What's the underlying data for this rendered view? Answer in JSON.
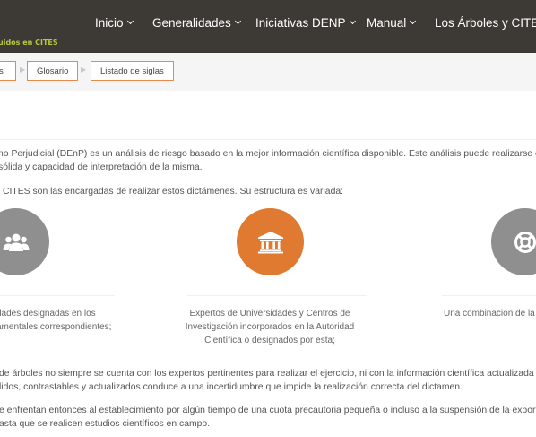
{
  "header": {
    "brand": "uidos en CITES",
    "nav": [
      {
        "label": "Inicio"
      },
      {
        "label": "Generalidades"
      },
      {
        "label": "Iniciativas DENP"
      },
      {
        "label": "Manual"
      },
      {
        "label": "Los Árboles y CITES"
      }
    ]
  },
  "breadcrumb": {
    "items": [
      {
        "label": "s"
      },
      {
        "label": "Glosario"
      },
      {
        "label": "Listado de siglas"
      }
    ]
  },
  "content": {
    "intro_line1": "no Perjudicial (DEnP) es un análisis de riesgo basado en la mejor información científica disponible. Este análisis puede realizarse en",
    "intro_line2": "sólida y capacidad de interpretación de la misma.",
    "structure_line": "CITES son las encargadas de realizar estos dictámenes. Su estructura es variada:",
    "columns": [
      {
        "icon": "group-icon",
        "lines": [
          "dades designadas en los",
          "amentales correspondientes;"
        ]
      },
      {
        "icon": "institution-icon",
        "lines": [
          "Expertos de Universidades y Centros de",
          "Investigación incorporados en la Autoridad",
          "Científica o designados por esta;"
        ]
      },
      {
        "icon": "lifebuoy-icon",
        "lines": [
          "Una combinación de la"
        ]
      }
    ],
    "para2_line1": "de árboles no siempre se cuenta con los expertos pertinentes para realizar el ejercicio, ni con la información científica actualizada pu",
    "para2_line2": "lidos, contrastables y actualizados conduce a una incertidumbre que impide la realización correcta del dictamen.",
    "para3_line1": "e enfrentan entonces al establecimiento por algún tiempo de una cuota precautoria pequeña o incluso a la suspensión de la exportac",
    "para3_line2": "asta que se realicen estudios científicos en campo."
  },
  "colors": {
    "topbar": "#3d3934",
    "brand": "#b5c93a",
    "accent": "#e07a30",
    "icon_grey": "#8f8f8f"
  }
}
